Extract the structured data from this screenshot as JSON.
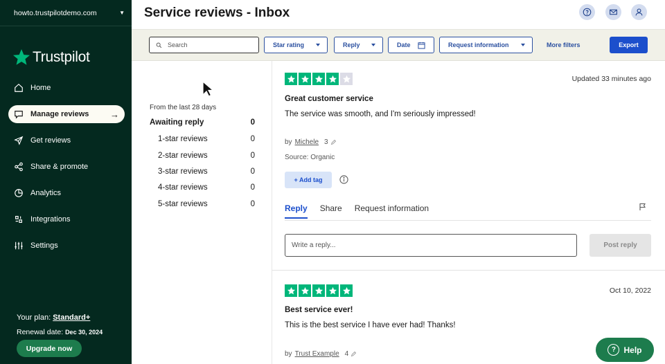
{
  "sidebar": {
    "domain": "howto.trustpilotdemo.com",
    "logo_text": "Trustpilot",
    "items": [
      {
        "label": "Home",
        "icon": "home-icon"
      },
      {
        "label": "Manage reviews",
        "icon": "chat-bubble-icon",
        "active": true
      },
      {
        "label": "Get reviews",
        "icon": "send-icon"
      },
      {
        "label": "Share & promote",
        "icon": "share-icon"
      },
      {
        "label": "Analytics",
        "icon": "pie-chart-icon"
      },
      {
        "label": "Integrations",
        "icon": "integrations-icon"
      },
      {
        "label": "Settings",
        "icon": "sliders-icon"
      }
    ],
    "plan_label": "Your plan:",
    "plan_name": "Standard+",
    "renewal_label": "Renewal date:",
    "renewal_date": "Dec 30, 2024",
    "upgrade_label": "Upgrade now"
  },
  "header": {
    "title": "Service reviews - Inbox"
  },
  "filters": {
    "search_placeholder": "Search",
    "star_rating": "Star rating",
    "reply": "Reply",
    "date": "Date",
    "request_information": "Request information",
    "more_filters": "More filters",
    "export": "Export"
  },
  "summary": {
    "period": "From the last 28 days",
    "awaiting_label": "Awaiting reply",
    "awaiting_count": "0",
    "rows": [
      {
        "label": "1-star reviews",
        "count": "0"
      },
      {
        "label": "2-star reviews",
        "count": "0"
      },
      {
        "label": "3-star reviews",
        "count": "0"
      },
      {
        "label": "4-star reviews",
        "count": "0"
      },
      {
        "label": "5-star reviews",
        "count": "0"
      }
    ]
  },
  "reviews": [
    {
      "rating": 4,
      "date": "Updated 33 minutes ago",
      "title": "Great customer service",
      "body": "The service was smooth, and I'm seriously impressed!",
      "by": "by",
      "author": "Michele",
      "author_count": "3",
      "source": "Source: Organic",
      "add_tag": "+ Add tag",
      "tabs": [
        "Reply",
        "Share",
        "Request information"
      ],
      "reply_placeholder": "Write a reply...",
      "post_reply": "Post reply"
    },
    {
      "rating": 5,
      "date": "Oct 10, 2022",
      "title": "Best service ever!",
      "body": "This is the best service I have ever had! Thanks!",
      "by": "by",
      "author": "Trust Example",
      "author_count": "4"
    }
  ],
  "help_label": "Help",
  "colors": {
    "sidebar_bg": "#04291f",
    "accent_green": "#00b67a",
    "primary_blue": "#1c4fcc",
    "filter_bar_bg": "#f1f1e8"
  }
}
